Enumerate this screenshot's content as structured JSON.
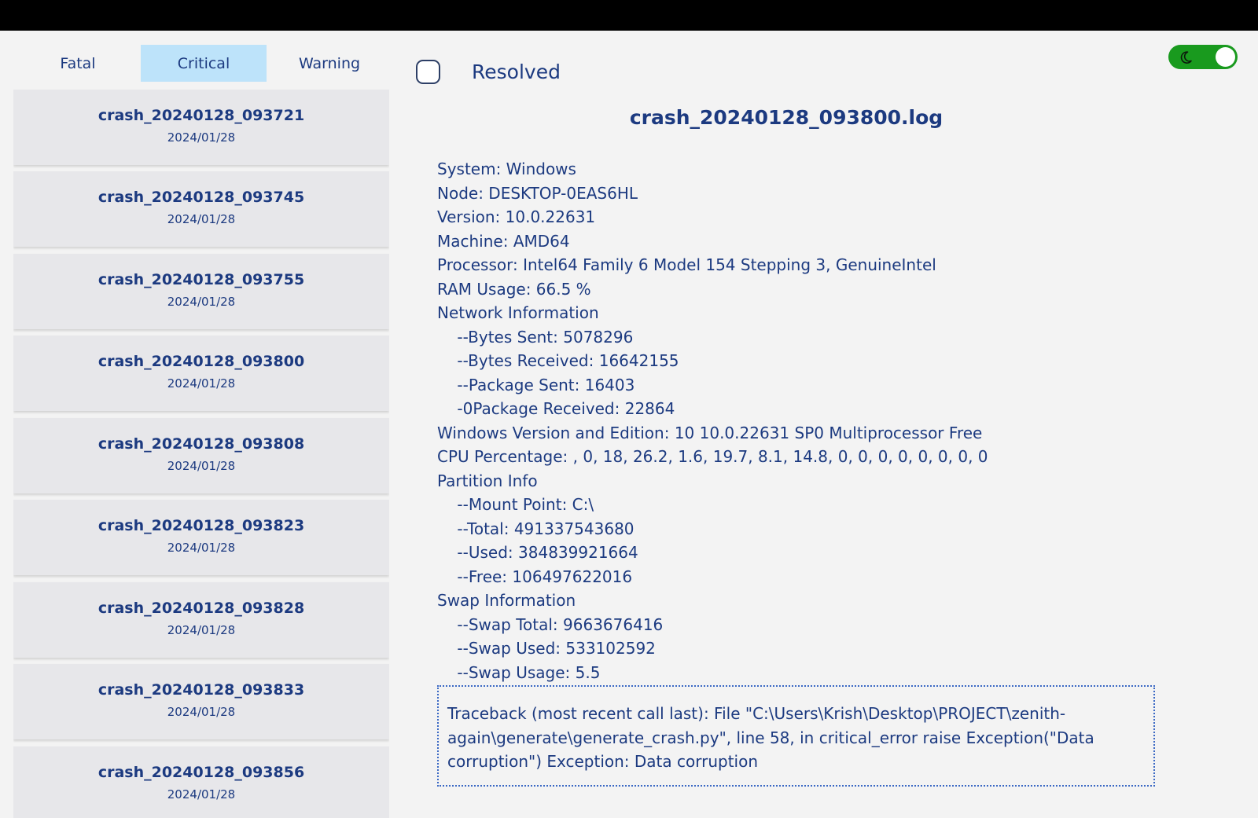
{
  "tabs": [
    {
      "label": "Fatal",
      "active": false
    },
    {
      "label": "Critical",
      "active": true
    },
    {
      "label": "Warning",
      "active": false
    }
  ],
  "crash_list": [
    {
      "name": "crash_20240128_093721",
      "date": "2024/01/28"
    },
    {
      "name": "crash_20240128_093745",
      "date": "2024/01/28"
    },
    {
      "name": "crash_20240128_093755",
      "date": "2024/01/28"
    },
    {
      "name": "crash_20240128_093800",
      "date": "2024/01/28"
    },
    {
      "name": "crash_20240128_093808",
      "date": "2024/01/28"
    },
    {
      "name": "crash_20240128_093823",
      "date": "2024/01/28"
    },
    {
      "name": "crash_20240128_093828",
      "date": "2024/01/28"
    },
    {
      "name": "crash_20240128_093833",
      "date": "2024/01/28"
    },
    {
      "name": "crash_20240128_093856",
      "date": "2024/01/28"
    }
  ],
  "resolved": {
    "label": "Resolved",
    "checked": false
  },
  "theme_toggle": {
    "icon": "moon-icon",
    "on": true,
    "color": "#199a1e"
  },
  "log": {
    "title": "crash_20240128_093800.log",
    "lines": [
      "System: Windows",
      "Node: DESKTOP-0EAS6HL",
      "Version: 10.0.22631",
      "Machine: AMD64",
      "Processor: Intel64 Family 6 Model 154 Stepping 3, GenuineIntel",
      "RAM Usage: 66.5 %",
      "Network Information",
      "    --Bytes Sent: 5078296",
      "    --Bytes Received: 16642155",
      "    --Package Sent: 16403",
      "    -0Package Received: 22864",
      "Windows Version and Edition: 10 10.0.22631 SP0 Multiprocessor Free",
      "CPU Percentage: , 0, 18, 26.2, 1.6, 19.7, 8.1, 14.8, 0, 0, 0, 0, 0, 0, 0, 0",
      "Partition Info",
      "    --Mount Point: C:\\",
      "    --Total: 491337543680",
      "    --Used: 384839921664",
      "    --Free: 106497622016",
      "Swap Information",
      "    --Swap Total: 9663676416",
      "    --Swap Used: 533102592",
      "    --Swap Usage: 5.5"
    ],
    "traceback": "Traceback (most recent call last): File \"C:\\Users\\Krish\\Desktop\\PROJECT\\zenith-again\\generate\\generate_crash.py\", line 58, in critical_error raise Exception(\"Data corruption\") Exception: Data corruption"
  }
}
